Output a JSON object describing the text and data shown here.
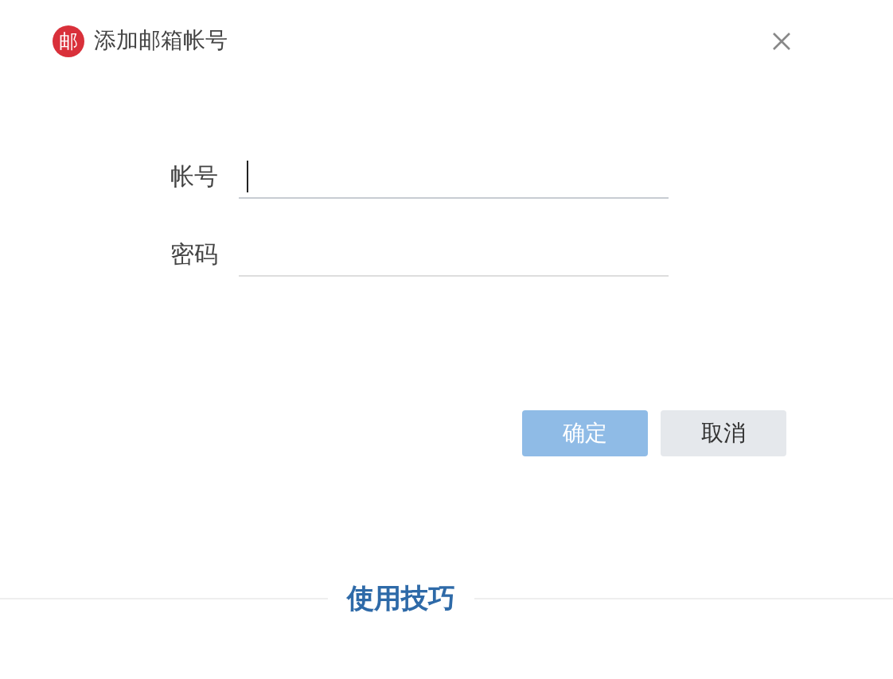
{
  "window": {
    "logo": "邮",
    "title": "添加邮箱帐号"
  },
  "fields": [
    {
      "label": "帐号",
      "focused": true
    },
    {
      "label": "密码",
      "focused": false
    }
  ],
  "buttons": [
    {
      "label": "确定",
      "kind": "primary",
      "disabled": true
    },
    {
      "label": "取消",
      "kind": "secondary",
      "disabled": false
    }
  ],
  "footer": {
    "heading": "使用技巧"
  }
}
